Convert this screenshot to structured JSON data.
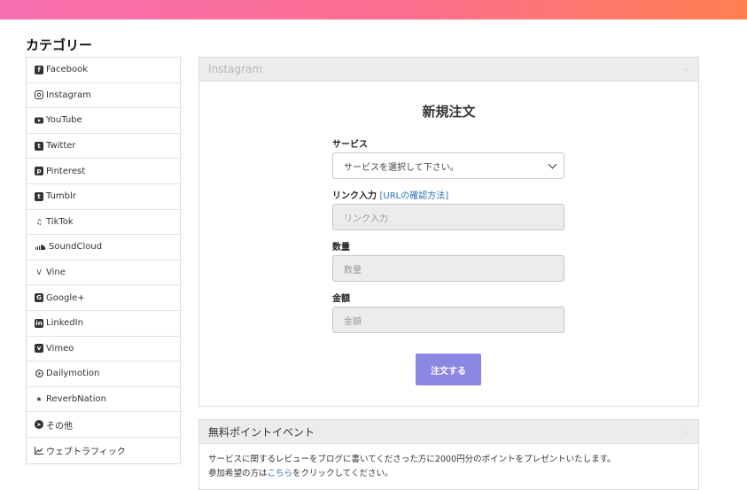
{
  "category": {
    "title": "カテゴリー",
    "items": [
      {
        "label": "Facebook",
        "icon": "facebook-icon"
      },
      {
        "label": "Instagram",
        "icon": "instagram-icon"
      },
      {
        "label": "YouTube",
        "icon": "youtube-icon"
      },
      {
        "label": "Twitter",
        "icon": "twitter-icon"
      },
      {
        "label": "Pinterest",
        "icon": "pinterest-icon"
      },
      {
        "label": "Tumblr",
        "icon": "tumblr-icon"
      },
      {
        "label": "TikTok",
        "icon": "tiktok-icon"
      },
      {
        "label": "SoundCloud",
        "icon": "soundcloud-icon"
      },
      {
        "label": "Vine",
        "icon": "vine-icon"
      },
      {
        "label": "Google+",
        "icon": "google-plus-icon"
      },
      {
        "label": "LinkedIn",
        "icon": "linkedin-icon"
      },
      {
        "label": "Vimeo",
        "icon": "vimeo-icon"
      },
      {
        "label": "Dailymotion",
        "icon": "dailymotion-icon"
      },
      {
        "label": "ReverbNation",
        "icon": "star-icon"
      },
      {
        "label": "その他",
        "icon": "telegram-icon"
      },
      {
        "label": "ウェブトラフィック",
        "icon": "line-chart-icon"
      }
    ]
  },
  "order_panel": {
    "header": "Instagram",
    "title": "新規注文",
    "service_label": "サービス",
    "service_select": "サービスを選択して下さい。",
    "link_label": "リンク入力",
    "link_help": "[URLの確認方法]",
    "link_placeholder": "リンク入力",
    "quantity_label": "数量",
    "quantity_placeholder": "数量",
    "amount_label": "金額",
    "amount_placeholder": "金額",
    "submit": "注文する"
  },
  "event_panel": {
    "header": "無料ポイントイベント",
    "line1": "サービスに関するレビューをブログに書いてくださった方に2000円分のポイントをプレゼントいたします。",
    "line2_before": "参加希望の方は",
    "line2_link": "こちら",
    "line2_after": "をクリックしてください。"
  },
  "colors": {
    "topbar_gradient": [
      "#f76fb0",
      "#fc6e8e",
      "#ff7f50"
    ],
    "submit_button": "#8c87e3",
    "link": "#2a6fb8"
  }
}
